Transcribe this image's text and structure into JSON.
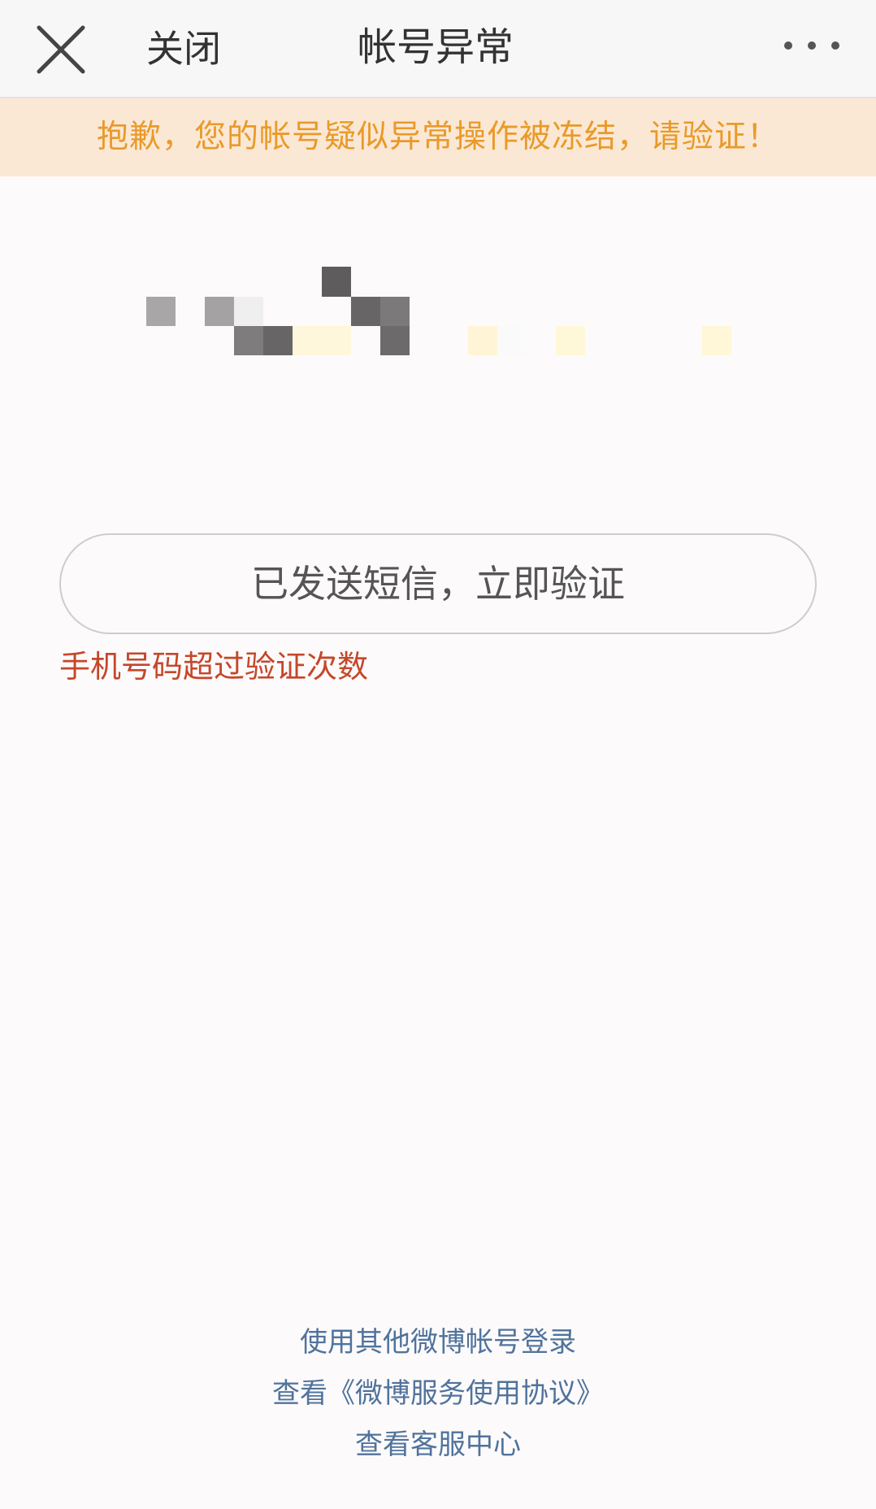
{
  "header": {
    "close_label": "关闭",
    "title": "帐号异常",
    "close_icon": "close-icon",
    "more_icon": "more-icon"
  },
  "banner": {
    "message": "抱歉，您的帐号疑似异常操作被冻结，请验证！"
  },
  "account": {
    "masked_content": "pixelated-account-info"
  },
  "verify": {
    "button_label": "已发送短信，立即验证",
    "error_message": "手机号码超过验证次数"
  },
  "footer": {
    "links": [
      "使用其他微博帐号登录",
      "查看《微博服务使用协议》",
      "查看客服中心"
    ]
  },
  "colors": {
    "banner_bg": "#fbe8d4",
    "banner_text": "#e99a2a",
    "error": "#c4472a",
    "link": "#50739c"
  }
}
